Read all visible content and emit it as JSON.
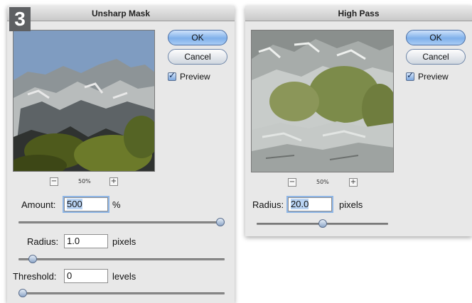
{
  "step_number": "3",
  "unsharp": {
    "title": "Unsharp Mask",
    "ok_label": "OK",
    "cancel_label": "Cancel",
    "preview_label": "Preview",
    "preview_checked": true,
    "zoom_minus": "−",
    "zoom_level": "50%",
    "zoom_plus": "+",
    "amount_label": "Amount:",
    "amount_value": "500",
    "amount_unit": "%",
    "amount_slider_fraction": 1.0,
    "radius_label": "Radius:",
    "radius_value": "1.0",
    "radius_unit": "pixels",
    "radius_slider_fraction": 0.05,
    "threshold_label": "Threshold:",
    "threshold_value": "0",
    "threshold_unit": "levels",
    "threshold_slider_fraction": 0.0
  },
  "highpass": {
    "title": "High Pass",
    "ok_label": "OK",
    "cancel_label": "Cancel",
    "preview_label": "Preview",
    "preview_checked": true,
    "zoom_minus": "−",
    "zoom_level": "50%",
    "zoom_plus": "+",
    "radius_label": "Radius:",
    "radius_value": "20.0",
    "radius_unit": "pixels",
    "radius_slider_fraction": 0.5
  },
  "colors": {
    "sky": "#7f9cc1",
    "rock": "#9aa0a2",
    "shrub": "#6c7a2a",
    "accent": "#7fb0ea"
  }
}
